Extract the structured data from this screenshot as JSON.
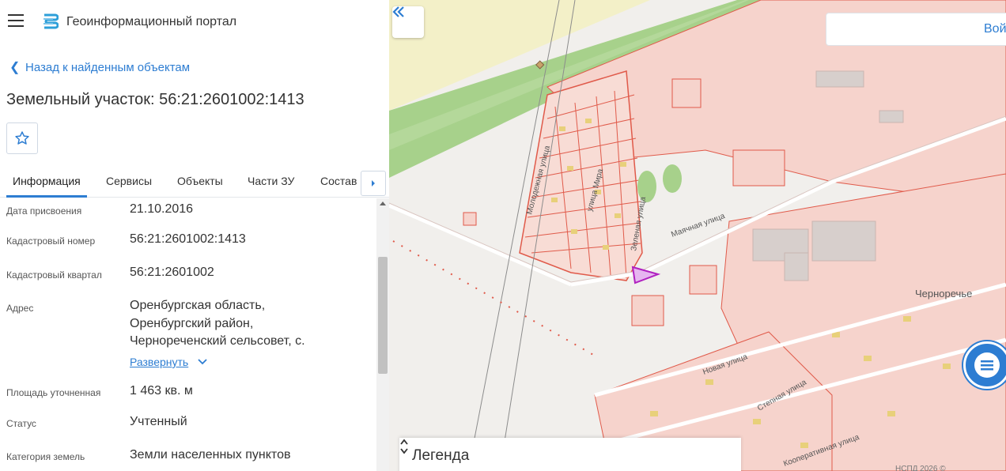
{
  "header": {
    "title": "Геоинформационный портал"
  },
  "nav": {
    "back_label": "Назад к найденным объектам"
  },
  "object": {
    "title": "Земельный участок: 56:21:2601002:1413"
  },
  "tabs": [
    {
      "label": "Информация"
    },
    {
      "label": "Сервисы"
    },
    {
      "label": "Объекты"
    },
    {
      "label": "Части ЗУ"
    },
    {
      "label": "Состав"
    }
  ],
  "properties": [
    {
      "label": "Дата присвоения",
      "value": "21.10.2016"
    },
    {
      "label": "Кадастровый номер",
      "value": "56:21:2601002:1413"
    },
    {
      "label": "Кадастровый квартал",
      "value": "56:21:2601002"
    },
    {
      "label": "Адрес",
      "lines": [
        "Оренбургская область,",
        "Оренбургский район,",
        "Чернореченский сельсовет, с."
      ]
    },
    {
      "label": "Площадь уточненная",
      "value": "1 463 кв. м"
    },
    {
      "label": "Статус",
      "value": "Учтенный"
    },
    {
      "label": "Категория земель",
      "value": "Земли населенных пунктов"
    }
  ],
  "expand_label": "Развернуть",
  "map": {
    "login_label": "Вой",
    "legend_title": "Легенда",
    "place_label": "Черноречье",
    "streets": [
      "Молодежная улица",
      "улица Мира",
      "Зеленая улица",
      "Маячная улица",
      "Новая улица",
      "Степная улица",
      "Кооперативная улица"
    ],
    "copyright": "НСПД 2026 ©",
    "colors": {
      "parcel_stroke": "#e05a4a",
      "parcel_fill": "#f6d3cc",
      "highlight": "#b020c0",
      "vegetation": "#a7d18b",
      "building": "#e8d07a"
    }
  }
}
